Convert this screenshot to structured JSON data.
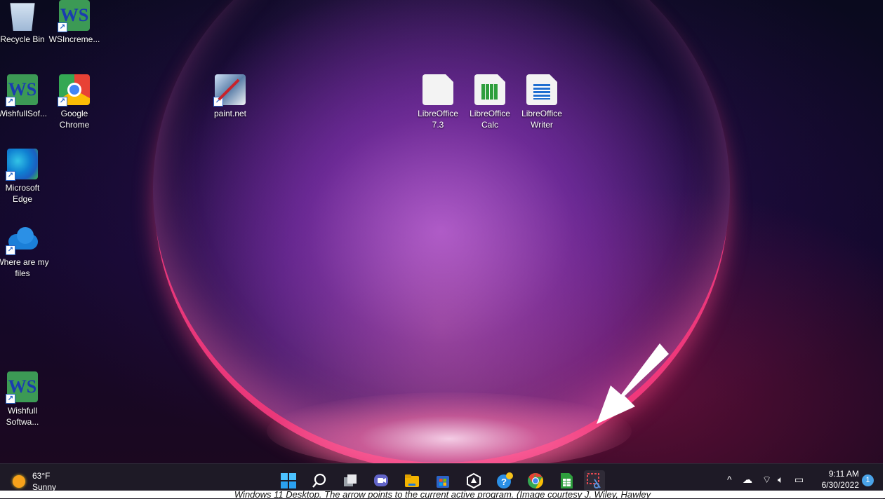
{
  "desktop": {
    "icons": [
      {
        "label": "Recycle Bin",
        "icon": "recycle-bin-icon"
      },
      {
        "label": "WSIncreme...",
        "icon": "wishfull-software-icon"
      },
      {
        "label": "WishfullSof...",
        "icon": "wishfull-software-icon"
      },
      {
        "label": "Google Chrome",
        "icon": "chrome-icon"
      },
      {
        "label": "Microsoft Edge",
        "icon": "edge-icon"
      },
      {
        "label": "Where are my files",
        "icon": "onedrive-icon"
      },
      {
        "label": "Wishfull Softwa...",
        "icon": "wishfull-software-icon"
      },
      {
        "label": "paint.net",
        "icon": "paint-net-icon"
      },
      {
        "label": "LibreOffice 7.3",
        "icon": "libreoffice-icon"
      },
      {
        "label": "LibreOffice Calc",
        "icon": "libreoffice-calc-icon"
      },
      {
        "label": "LibreOffice Writer",
        "icon": "libreoffice-writer-icon"
      }
    ]
  },
  "taskbar": {
    "weather": {
      "temp": "63°F",
      "condition": "Sunny"
    },
    "apps": [
      "start",
      "search",
      "task-view",
      "chat",
      "file-explorer",
      "microsoft-store",
      "libreoffice",
      "get-help",
      "chrome",
      "libreoffice-calc",
      "snipping-tool"
    ],
    "clock": {
      "time": "9:11 AM",
      "date": "6/30/2022"
    },
    "notification_count": "1"
  },
  "caption": "Windows 11 Desktop. The arrow points to the current active program. (Image courtesy J. Wiley, Hawley"
}
